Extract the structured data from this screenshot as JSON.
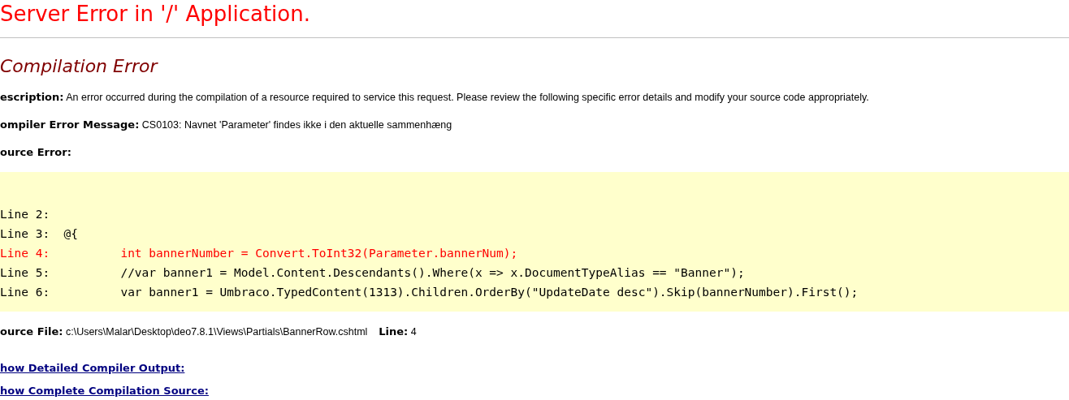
{
  "title": "Server Error in '/' Application.",
  "error_heading": "Compilation Error",
  "fields": [
    {
      "label": "escription:",
      "text": "An error occurred during the compilation of a resource required to service this request. Please review the following specific error details and modify your source code appropriately."
    },
    {
      "label": "ompiler Error Message:",
      "text": "CS0103: Navnet 'Parameter' findes ikke i den aktuelle sammenhæng"
    },
    {
      "label": "ource Error:"
    }
  ],
  "source_lines": [
    {
      "label": "Line 2:",
      "highlighted": false
    },
    {
      "label": "Line 3:",
      "code": "@{",
      "highlighted": false
    },
    {
      "label": "Line 4:",
      "code": "        int bannerNumber = Convert.ToInt32(Parameter.bannerNum);",
      "highlighted": true
    },
    {
      "label": "Line 5:",
      "code": "        //var banner1 = Model.Content.Descendants().Where(x => x.DocumentTypeAlias == \"Banner\");",
      "highlighted": false
    },
    {
      "label": "Line 6:",
      "code": "        var banner1 = Umbraco.TypedContent(1313).Children.OrderBy(\"UpdateDate desc\").Skip(bannerNumber).First();",
      "highlighted": false
    }
  ],
  "source_file": {
    "label": "ource File:",
    "path": "c:\\Users\\Malar\\Desktop\\deo7.8.1\\Views\\Partials\\BannerRow.cshtml",
    "line_label": "Line:",
    "line": "4"
  },
  "links": [
    "how Detailed Compiler Output:",
    "how Complete Compilation Source:"
  ]
}
